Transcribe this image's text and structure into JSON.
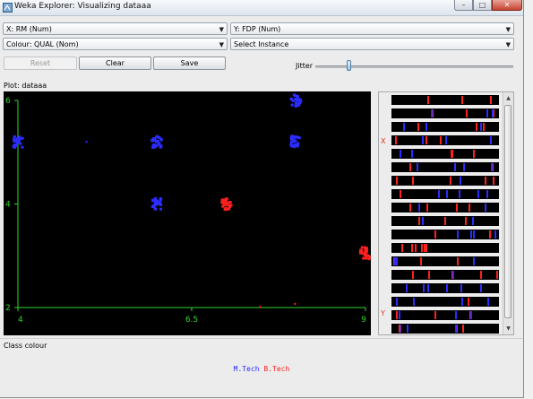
{
  "window": {
    "title": "Weka Explorer: Visualizing dataaa"
  },
  "controls": {
    "x_axis": "X: RM (Num)",
    "y_axis": "Y: FDP (Num)",
    "colour": "Colour: QUAL (Nom)",
    "instance": "Select Instance",
    "reset_label": "Reset",
    "clear_label": "Clear",
    "save_label": "Save",
    "jitter_label": "Jitter",
    "jitter_level": 0.16
  },
  "plot": {
    "title": "Plot: dataaa"
  },
  "attribute_panel": {
    "x_marker": "X",
    "y_marker": "Y"
  },
  "class_colour": {
    "label": "Class colour",
    "classes": [
      {
        "name": "M.Tech",
        "color": "#2c2cff"
      },
      {
        "name": "B.Tech",
        "color": "#ff2020"
      }
    ]
  },
  "chart_data": {
    "type": "scatter",
    "xlabel": "RM",
    "ylabel": "FDP",
    "xlim": [
      4,
      9
    ],
    "ylim": [
      2,
      6
    ],
    "x_ticks": [
      "4",
      "6.5",
      "9"
    ],
    "y_ticks": [
      "2",
      "4",
      "6"
    ],
    "axis_color": "#2fd62f",
    "series": [
      {
        "name": "M.Tech",
        "color": "#2c2cff",
        "points": [
          [
            4,
            5.2
          ],
          [
            6,
            5.2
          ],
          [
            8,
            5.2
          ],
          [
            8,
            6.0
          ],
          [
            6,
            4.0
          ],
          [
            5,
            5.2
          ]
        ]
      },
      {
        "name": "B.Tech",
        "color": "#ff2020",
        "points": [
          [
            7,
            4.0
          ],
          [
            9,
            3.05
          ],
          [
            7.5,
            2.0
          ],
          [
            8.0,
            2.05
          ]
        ]
      }
    ]
  }
}
